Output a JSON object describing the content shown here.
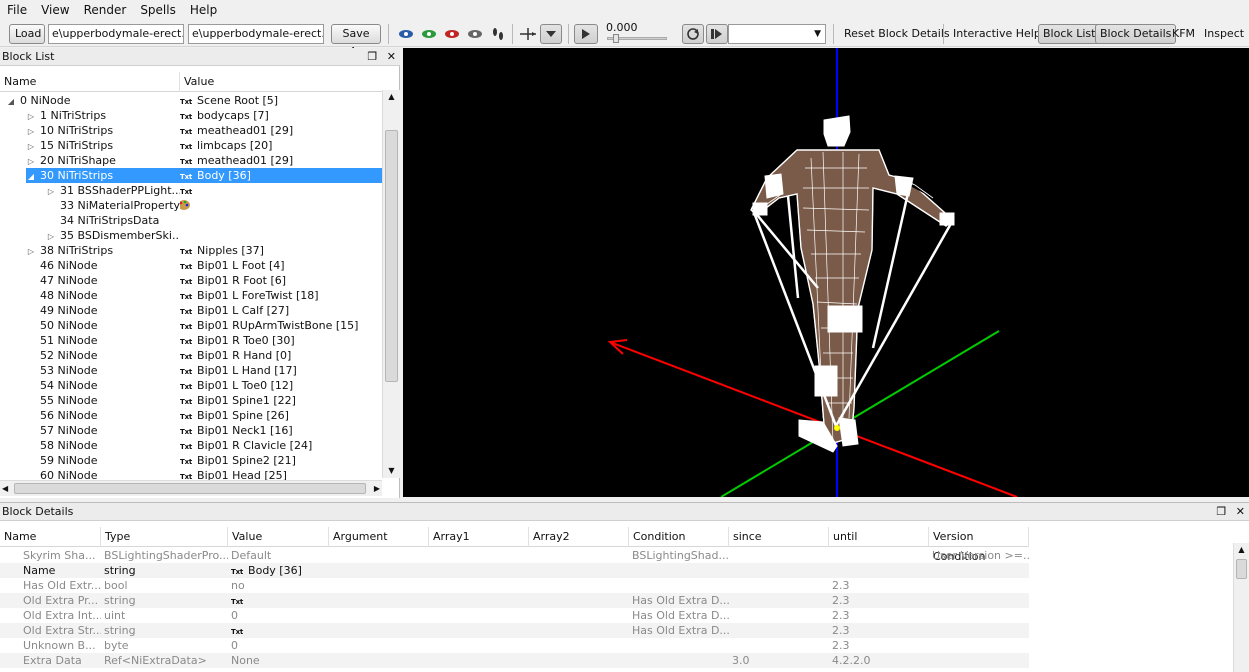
{
  "menubar": [
    "File",
    "View",
    "Render",
    "Spells",
    "Help"
  ],
  "toolbar": {
    "load_label": "Load",
    "load_path": "e\\upperbodymale-erect.nif",
    "save_path": "e\\upperbodymale-erect.nif",
    "save_as_label": "Save As",
    "time_value": "0.000",
    "reset_block_details": "Reset Block Details",
    "interactive_help": "Interactive Help",
    "block_list": "Block List",
    "block_details": "Block Details",
    "kfm": "KFM",
    "inspect": "Inspect"
  },
  "blocklist": {
    "title": "Block List",
    "col_name": "Name",
    "col_value": "Value",
    "rows": [
      {
        "name": "0 NiNode",
        "value": "Scene Root [5]",
        "indent": 0,
        "arrow": "open",
        "badge": "Txt"
      },
      {
        "name": "1 NiTriStrips",
        "value": "bodycaps [7]",
        "indent": 1,
        "arrow": "closed",
        "badge": "Txt"
      },
      {
        "name": "10 NiTriStrips",
        "value": "meathead01 [29]",
        "indent": 1,
        "arrow": "closed",
        "badge": "Txt"
      },
      {
        "name": "15 NiTriStrips",
        "value": "limbcaps [20]",
        "indent": 1,
        "arrow": "closed",
        "badge": "Txt"
      },
      {
        "name": "20 NiTriShape",
        "value": "meathead01 [29]",
        "indent": 1,
        "arrow": "closed",
        "badge": "Txt"
      },
      {
        "name": "30 NiTriStrips",
        "value": "Body [36]",
        "indent": 1,
        "arrow": "open",
        "badge": "Txt",
        "selected": true
      },
      {
        "name": "31 BSShaderPPLight...",
        "value": "",
        "indent": 2,
        "arrow": "closed",
        "badge": "Txt"
      },
      {
        "name": "33 NiMaterialProperty",
        "value": "",
        "indent": 2,
        "arrow": "",
        "badge": "",
        "palette": true
      },
      {
        "name": "34 NiTriStripsData",
        "value": "",
        "indent": 2,
        "arrow": "",
        "badge": ""
      },
      {
        "name": "35 BSDismemberSki...",
        "value": "",
        "indent": 2,
        "arrow": "closed",
        "badge": ""
      },
      {
        "name": "38 NiTriStrips",
        "value": "Nipples [37]",
        "indent": 1,
        "arrow": "closed",
        "badge": "Txt"
      },
      {
        "name": "46 NiNode",
        "value": "Bip01 L Foot [4]",
        "indent": 1,
        "arrow": "",
        "badge": "Txt"
      },
      {
        "name": "47 NiNode",
        "value": "Bip01 R Foot [6]",
        "indent": 1,
        "arrow": "",
        "badge": "Txt"
      },
      {
        "name": "48 NiNode",
        "value": "Bip01 L ForeTwist [18]",
        "indent": 1,
        "arrow": "",
        "badge": "Txt"
      },
      {
        "name": "49 NiNode",
        "value": "Bip01 L Calf [27]",
        "indent": 1,
        "arrow": "",
        "badge": "Txt"
      },
      {
        "name": "50 NiNode",
        "value": "Bip01 RUpArmTwistBone [15]",
        "indent": 1,
        "arrow": "",
        "badge": "Txt"
      },
      {
        "name": "51 NiNode",
        "value": "Bip01 R Toe0 [30]",
        "indent": 1,
        "arrow": "",
        "badge": "Txt"
      },
      {
        "name": "52 NiNode",
        "value": "Bip01 R Hand [0]",
        "indent": 1,
        "arrow": "",
        "badge": "Txt"
      },
      {
        "name": "53 NiNode",
        "value": "Bip01 L Hand [17]",
        "indent": 1,
        "arrow": "",
        "badge": "Txt"
      },
      {
        "name": "54 NiNode",
        "value": "Bip01 L Toe0 [12]",
        "indent": 1,
        "arrow": "",
        "badge": "Txt"
      },
      {
        "name": "55 NiNode",
        "value": "Bip01 Spine1 [22]",
        "indent": 1,
        "arrow": "",
        "badge": "Txt"
      },
      {
        "name": "56 NiNode",
        "value": "Bip01 Spine [26]",
        "indent": 1,
        "arrow": "",
        "badge": "Txt"
      },
      {
        "name": "57 NiNode",
        "value": "Bip01 Neck1 [16]",
        "indent": 1,
        "arrow": "",
        "badge": "Txt"
      },
      {
        "name": "58 NiNode",
        "value": "Bip01 R Clavicle [24]",
        "indent": 1,
        "arrow": "",
        "badge": "Txt"
      },
      {
        "name": "59 NiNode",
        "value": "Bip01 Spine2 [21]",
        "indent": 1,
        "arrow": "",
        "badge": "Txt"
      },
      {
        "name": "60 NiNode",
        "value": "Bip01 Head [25]",
        "indent": 1,
        "arrow": "",
        "badge": "Txt"
      }
    ]
  },
  "details": {
    "title": "Block Details",
    "columns": [
      "Name",
      "Type",
      "Value",
      "Argument",
      "Array1",
      "Array2",
      "Condition",
      "since",
      "until",
      "Version Condition"
    ],
    "rows": [
      {
        "name": "Skyrim Sha...",
        "type": "BSLightingShaderPro...",
        "value": "Default",
        "badge": "",
        "argument": "",
        "array1": "",
        "array2": "",
        "condition": "BSLightingShad...",
        "since": "",
        "until": "",
        "vercond": "User Version >=...",
        "active": false
      },
      {
        "name": "Name",
        "type": "string",
        "value": "Body [36]",
        "badge": "Txt",
        "argument": "",
        "array1": "",
        "array2": "",
        "condition": "",
        "since": "",
        "until": "",
        "vercond": "",
        "active": true
      },
      {
        "name": "Has Old Extr...",
        "type": "bool",
        "value": "no",
        "badge": "",
        "argument": "",
        "array1": "",
        "array2": "",
        "condition": "",
        "since": "",
        "until": "2.3",
        "vercond": "",
        "active": false
      },
      {
        "name": "Old Extra Pr...",
        "type": "string",
        "value": "",
        "badge": "Txt",
        "argument": "",
        "array1": "",
        "array2": "",
        "condition": "Has Old Extra D...",
        "since": "",
        "until": "2.3",
        "vercond": "",
        "active": false
      },
      {
        "name": "Old Extra Int...",
        "type": "uint",
        "value": "0",
        "badge": "",
        "argument": "",
        "array1": "",
        "array2": "",
        "condition": "Has Old Extra D...",
        "since": "",
        "until": "2.3",
        "vercond": "",
        "active": false
      },
      {
        "name": "Old Extra Str...",
        "type": "string",
        "value": "",
        "badge": "Txt",
        "argument": "",
        "array1": "",
        "array2": "",
        "condition": "Has Old Extra D...",
        "since": "",
        "until": "2.3",
        "vercond": "",
        "active": false
      },
      {
        "name": "Unknown B...",
        "type": "byte",
        "value": "0",
        "badge": "",
        "argument": "",
        "array1": "",
        "array2": "",
        "condition": "",
        "since": "",
        "until": "2.3",
        "vercond": "",
        "active": false
      },
      {
        "name": "Extra Data",
        "type": "Ref<NiExtraData>",
        "value": "None",
        "badge": "",
        "argument": "",
        "array1": "",
        "array2": "",
        "condition": "",
        "since": "3.0",
        "until": "4.2.2.0",
        "vercond": "",
        "active": false
      }
    ]
  },
  "colors": {
    "selection": "#3399ff",
    "viewport_bg": "#000000",
    "axis_x": "#ff0000",
    "axis_y": "#00cc00",
    "axis_z": "#0000ff"
  }
}
